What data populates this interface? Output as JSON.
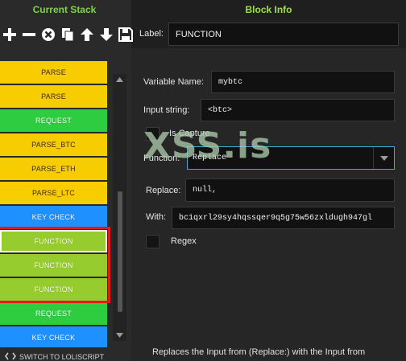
{
  "left": {
    "title": "Current Stack",
    "toolbar": [
      {
        "name": "add-icon"
      },
      {
        "name": "remove-icon"
      },
      {
        "name": "clear-icon"
      },
      {
        "name": "copy-icon"
      },
      {
        "name": "move-up-icon"
      },
      {
        "name": "move-down-icon"
      },
      {
        "name": "save-icon"
      }
    ],
    "stack": [
      {
        "label": "PARSE",
        "color": "yellow"
      },
      {
        "label": "PARSE",
        "color": "yellow"
      },
      {
        "label": "REQUEST",
        "color": "green"
      },
      {
        "label": "PARSE_BTC",
        "color": "yellow"
      },
      {
        "label": "PARSE_ETH",
        "color": "yellow"
      },
      {
        "label": "PARSE_LTC",
        "color": "yellow"
      },
      {
        "label": "KEY CHECK",
        "color": "blue"
      },
      {
        "label": "FUNCTION",
        "color": "lime",
        "selected": true
      },
      {
        "label": "FUNCTION",
        "color": "lime"
      },
      {
        "label": "FUNCTION",
        "color": "lime"
      },
      {
        "label": "REQUEST",
        "color": "green"
      },
      {
        "label": "KEY CHECK",
        "color": "blue"
      }
    ],
    "switch_label": "SWITCH TO LOLISCRIPT"
  },
  "right": {
    "title": "Block Info",
    "label_caption": "Label:",
    "label_value": "FUNCTION",
    "variable_name_caption": "Variable Name:",
    "variable_name_value": "mybtc",
    "input_string_caption": "Input string:",
    "input_string_value": "<btc>",
    "is_capture_label": "Is Capture",
    "function_caption": "Function:",
    "function_value": "Replace",
    "replace_caption": "Replace:",
    "replace_value": "null,",
    "with_caption": "With:",
    "with_value": "bc1qxrl29sy4hqssqer9q5g75w56zxldugh947gl",
    "regex_label": "Regex",
    "description": "Replaces the Input from (Replace:) with the Input from"
  },
  "watermark": "XSS.is",
  "colors": {
    "yellow": "#f7cc00",
    "green": "#2ecc40",
    "blue": "#1e90ff",
    "lime": "#97cc2e",
    "selection_frame": "#e0191e",
    "title_green": "#7fd24a"
  }
}
